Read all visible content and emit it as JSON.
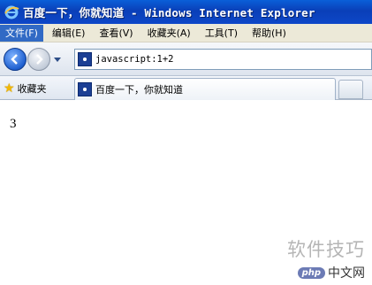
{
  "window": {
    "title": "百度一下，你就知道 - Windows Internet Explorer"
  },
  "menubar": {
    "items": [
      {
        "label": "文件(F)"
      },
      {
        "label": "编辑(E)"
      },
      {
        "label": "查看(V)"
      },
      {
        "label": "收藏夹(A)"
      },
      {
        "label": "工具(T)"
      },
      {
        "label": "帮助(H)"
      }
    ]
  },
  "address": {
    "url": "javascript:1+2"
  },
  "favorites": {
    "label": "收藏夹",
    "tab_title": "百度一下，你就知道"
  },
  "page": {
    "result": "3"
  },
  "watermark": {
    "text": "软件技巧",
    "brand_badge": "php",
    "brand_text": "中文网"
  },
  "colors": {
    "titlebar": "#0a47c4",
    "menu_bg": "#ece9d8",
    "active_menu": "#316ac5"
  }
}
